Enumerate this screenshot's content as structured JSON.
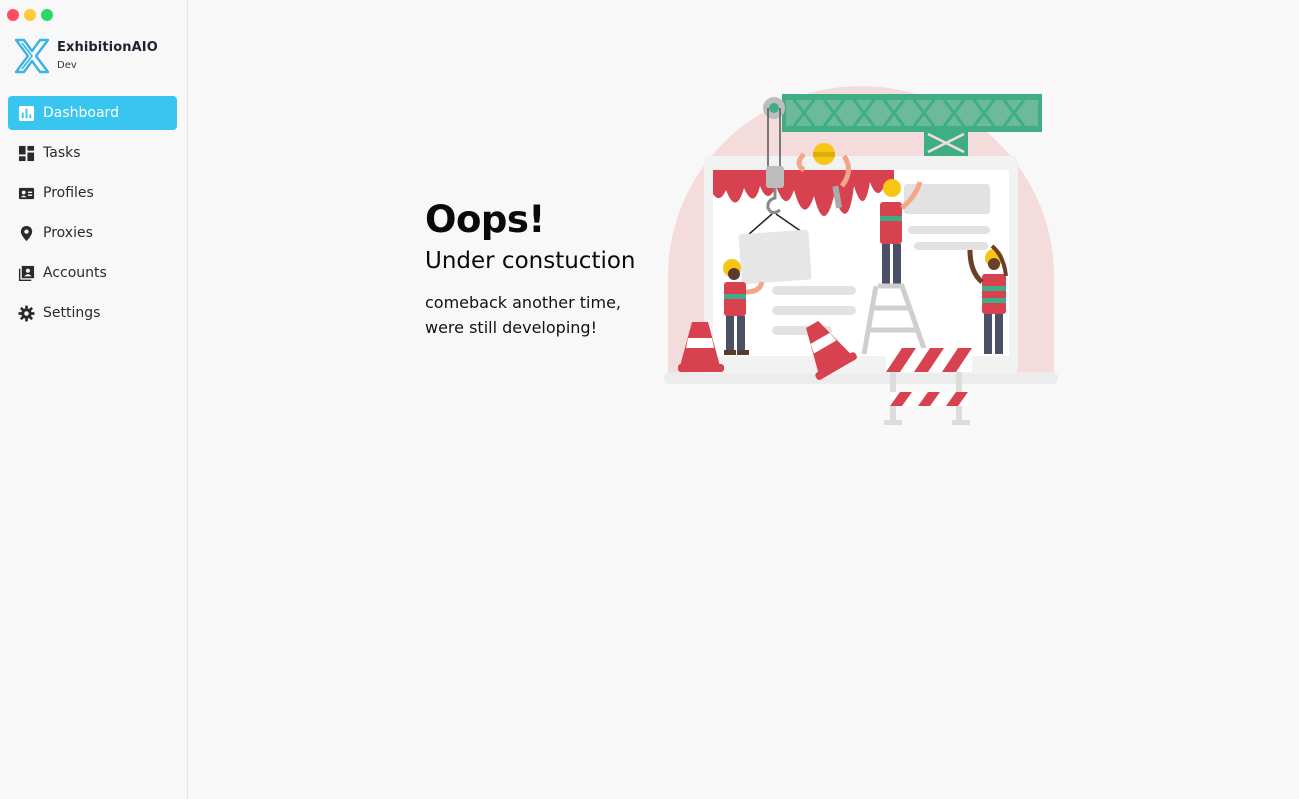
{
  "window": {
    "controls": [
      "close",
      "minimize",
      "maximize"
    ]
  },
  "brand": {
    "name": "ExhibitionAIO",
    "subtitle": "Dev",
    "logo_icon": "x-logo-icon",
    "accent": "#38c6f0"
  },
  "sidebar": {
    "items": [
      {
        "label": "Dashboard",
        "icon": "bar-chart-icon",
        "active": true
      },
      {
        "label": "Tasks",
        "icon": "grid-icon",
        "active": false
      },
      {
        "label": "Profiles",
        "icon": "id-card-icon",
        "active": false
      },
      {
        "label": "Proxies",
        "icon": "map-pin-icon",
        "active": false
      },
      {
        "label": "Accounts",
        "icon": "contact-icon",
        "active": false
      },
      {
        "label": "Settings",
        "icon": "gear-icon",
        "active": false
      }
    ]
  },
  "main": {
    "title": "Oops!",
    "subtitle": "Under constuction",
    "message": "comeback another time, were still developing!",
    "illustration": "under-construction-illustration"
  },
  "colors": {
    "active_bg": "#38c6f0",
    "crane": "#3fae87",
    "paint": "#d8414f",
    "helmet": "#f7c615"
  }
}
